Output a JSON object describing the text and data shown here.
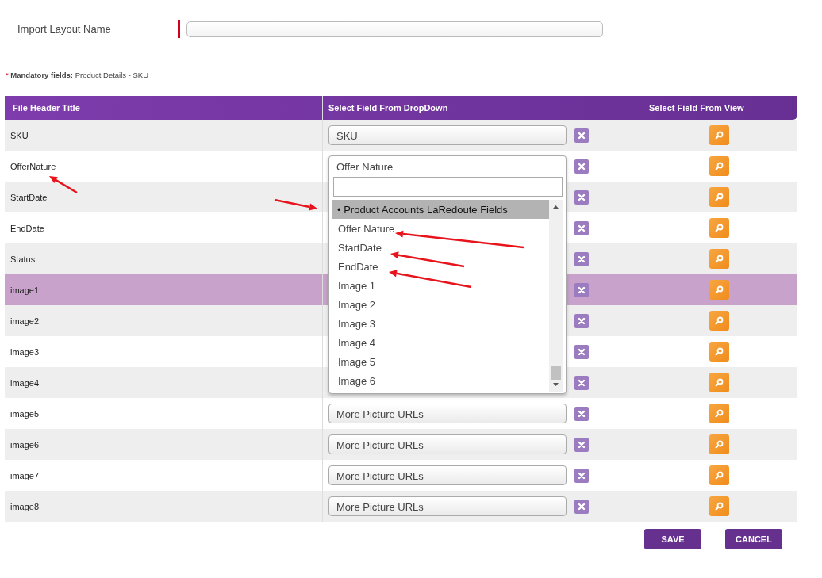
{
  "layout_name": {
    "label": "Import Layout Name",
    "placeholder_required": true
  },
  "mandatory_note": {
    "marker": "*",
    "text": "**Mandatory fields:** Product Details - SKU"
  },
  "table": {
    "columns": [
      "File Header Title",
      "Select Field From DropDown",
      "Select Field From View"
    ],
    "rows": [
      {
        "title": "SKU",
        "field": "SKU",
        "selected": false
      },
      {
        "title": "OfferNature",
        "field": "Offer Nature",
        "selected": false,
        "dropdown": {
          "items": [
            {
              "label": "• Product Accounts LaRedoute Fields",
              "kind": "group",
              "highlighted": true
            },
            {
              "label": "Offer Nature",
              "kind": "option",
              "highlighted": false
            },
            {
              "label": "StartDate",
              "kind": "option",
              "highlighted": false
            },
            {
              "label": "EndDate",
              "kind": "option",
              "highlighted": false
            },
            {
              "label": "Image 1",
              "kind": "option",
              "highlighted": false
            },
            {
              "label": "Image 2",
              "kind": "option",
              "highlighted": false
            },
            {
              "label": "Image 3",
              "kind": "option",
              "highlighted": false
            },
            {
              "label": "Image 4",
              "kind": "option",
              "highlighted": false
            },
            {
              "label": "Image 5",
              "kind": "option",
              "highlighted": false
            },
            {
              "label": "Image 6",
              "kind": "option",
              "highlighted": false
            }
          ]
        }
      },
      {
        "title": "StartDate",
        "selected": false
      },
      {
        "title": "EndDate",
        "selected": false
      },
      {
        "title": "Status",
        "selected": false
      },
      {
        "title": "image1",
        "selected": true
      },
      {
        "title": "image2",
        "selected": false
      },
      {
        "title": "image3",
        "selected": false
      },
      {
        "title": "image4",
        "selected": false
      },
      {
        "title": "image5",
        "field": "More Picture URLs",
        "selected": false
      },
      {
        "title": "image6",
        "field": "More Picture URLs",
        "selected": false
      },
      {
        "title": "image7",
        "field": "More Picture URLs",
        "selected": false
      },
      {
        "title": "image8",
        "field": "More Picture URLs",
        "selected": false
      }
    ]
  },
  "buttons": [
    "SAVE",
    "CANCEL"
  ]
}
